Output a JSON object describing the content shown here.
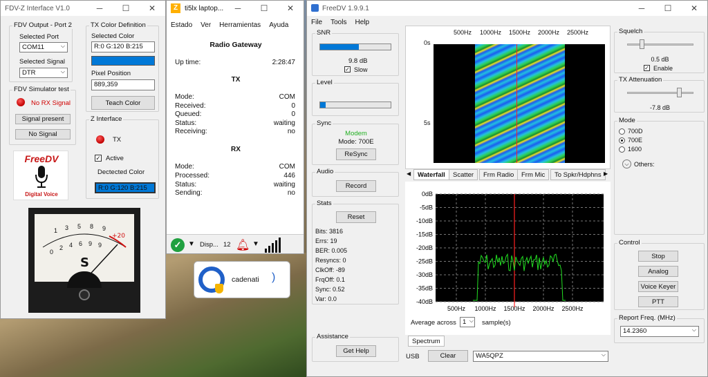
{
  "fdvz": {
    "title": "FDV-Z Interface V1.0",
    "output_group": "FDV Output - Port 2",
    "selected_port_label": "Selected Port",
    "selected_port": "COM11",
    "selected_signal_label": "Selected Signal",
    "selected_signal": "DTR",
    "simulator_group": "FDV Simulator test",
    "rx_status": "No RX Signal",
    "signal_present_btn": "Signal present",
    "no_signal_btn": "No Signal",
    "txcolor_group": "TX Color Definition",
    "selected_color_label": "Selected Color",
    "selected_color": "R:0 G:120 B:215",
    "color_swatch": "#0078d7",
    "pixel_position_label": "Pixel Position",
    "pixel_position": "889,359",
    "teach_btn": "Teach Color",
    "zinterface_group": "Z Interface",
    "tx_label": "TX",
    "active_label": "Active",
    "detected_color_label": "Dectected Color",
    "detected_color": "R:0 G:120 B:215",
    "logo_text": "FreeDV",
    "logo_sub": "Digital Voice",
    "meter": {
      "s_label": "S",
      "plus20": "+20",
      "top_scale": [
        "1",
        "3",
        "5",
        "8",
        "9"
      ],
      "bottom_scale": [
        "0",
        "2",
        "4",
        "6",
        "9",
        "9"
      ]
    }
  },
  "gateway": {
    "title": "ti5lx laptop...",
    "menu": [
      "Estado",
      "Ver",
      "Herramientas",
      "Ayuda"
    ],
    "heading": "Radio Gateway",
    "uptime_label": "Up time:",
    "uptime": "2:28:47",
    "tx_heading": "TX",
    "tx_rows": [
      [
        "Mode:",
        "COM"
      ],
      [
        "Received:",
        "0"
      ],
      [
        "Queued:",
        "0"
      ],
      [
        "Status:",
        "waiting"
      ],
      [
        "Receiving:",
        "no"
      ]
    ],
    "rx_heading": "RX",
    "rx_rows": [
      [
        "Mode:",
        "COM"
      ],
      [
        "Processed:",
        "446"
      ],
      [
        "Status:",
        "waiting"
      ],
      [
        "Sending:",
        "no"
      ]
    ],
    "status_label": "Disp...",
    "status_count": "12"
  },
  "notif": {
    "text": "cadenati",
    "chevron": ")"
  },
  "freedv": {
    "title": "FreeDV 1.9.9.1",
    "menu": [
      "File",
      "Tools",
      "Help"
    ],
    "snr_group": "SNR",
    "snr_value": "9.8 dB",
    "snr_fill": 0.55,
    "slow_label": "Slow",
    "level_group": "Level",
    "level_fill": 0.08,
    "sync_group": "Sync",
    "modem_label": "Modem",
    "mode_text": "Mode: 700E",
    "resync_btn": "ReSync",
    "audio_group": "Audio",
    "record_btn": "Record",
    "stats_group": "Stats",
    "reset_btn": "Reset",
    "stats": [
      "Bits: 3816",
      "Errs: 19",
      "BER: 0.005",
      "Resyncs: 0",
      "ClkOff: -89",
      "FrqOff: 0.1",
      "Sync: 0.52",
      "Var:  0.0"
    ],
    "assistance_group": "Assistance",
    "help_btn": "Get Help",
    "freq_labels": [
      "500Hz",
      "1000Hz",
      "1500Hz",
      "2000Hz",
      "2500Hz"
    ],
    "time_labels": [
      "0s",
      "5s"
    ],
    "tabs": [
      "Waterfall",
      "Scatter",
      "Frm Radio",
      "Frm Mic",
      "To Spkr/Hdphns"
    ],
    "db_labels": [
      "0dB",
      "-5dB",
      "-10dB",
      "-15dB",
      "-20dB",
      "-25dB",
      "-30dB",
      "-35dB",
      "-40dB"
    ],
    "avg_label": "Average across",
    "avg_value": "1",
    "samples_label": "sample(s)",
    "spectrum_tab": "Spectrum",
    "usb_label": "USB",
    "clear_btn": "Clear",
    "callsign": "WA5QPZ",
    "squelch_group": "Squelch",
    "squelch_value": "0.5 dB",
    "squelch_level": 0.22,
    "enable_label": "Enable",
    "txatt_group": "TX Attenuation",
    "txatt_value": "-7.8 dB",
    "txatt_level": 0.78,
    "mode_group": "Mode",
    "modes": [
      "700D",
      "700E",
      "1600"
    ],
    "others_label": "Others:",
    "control_group": "Control",
    "stop_btn": "Stop",
    "analog_btn": "Analog",
    "voice_keyer_btn": "Voice Keyer",
    "ptt_btn": "PTT",
    "report_group": "Report Freq. (MHz)",
    "report_freq": "14.2360",
    "colors": {
      "accent": "#0078d7",
      "spectrum": "#22e022",
      "cursor": "#ff2020"
    }
  }
}
